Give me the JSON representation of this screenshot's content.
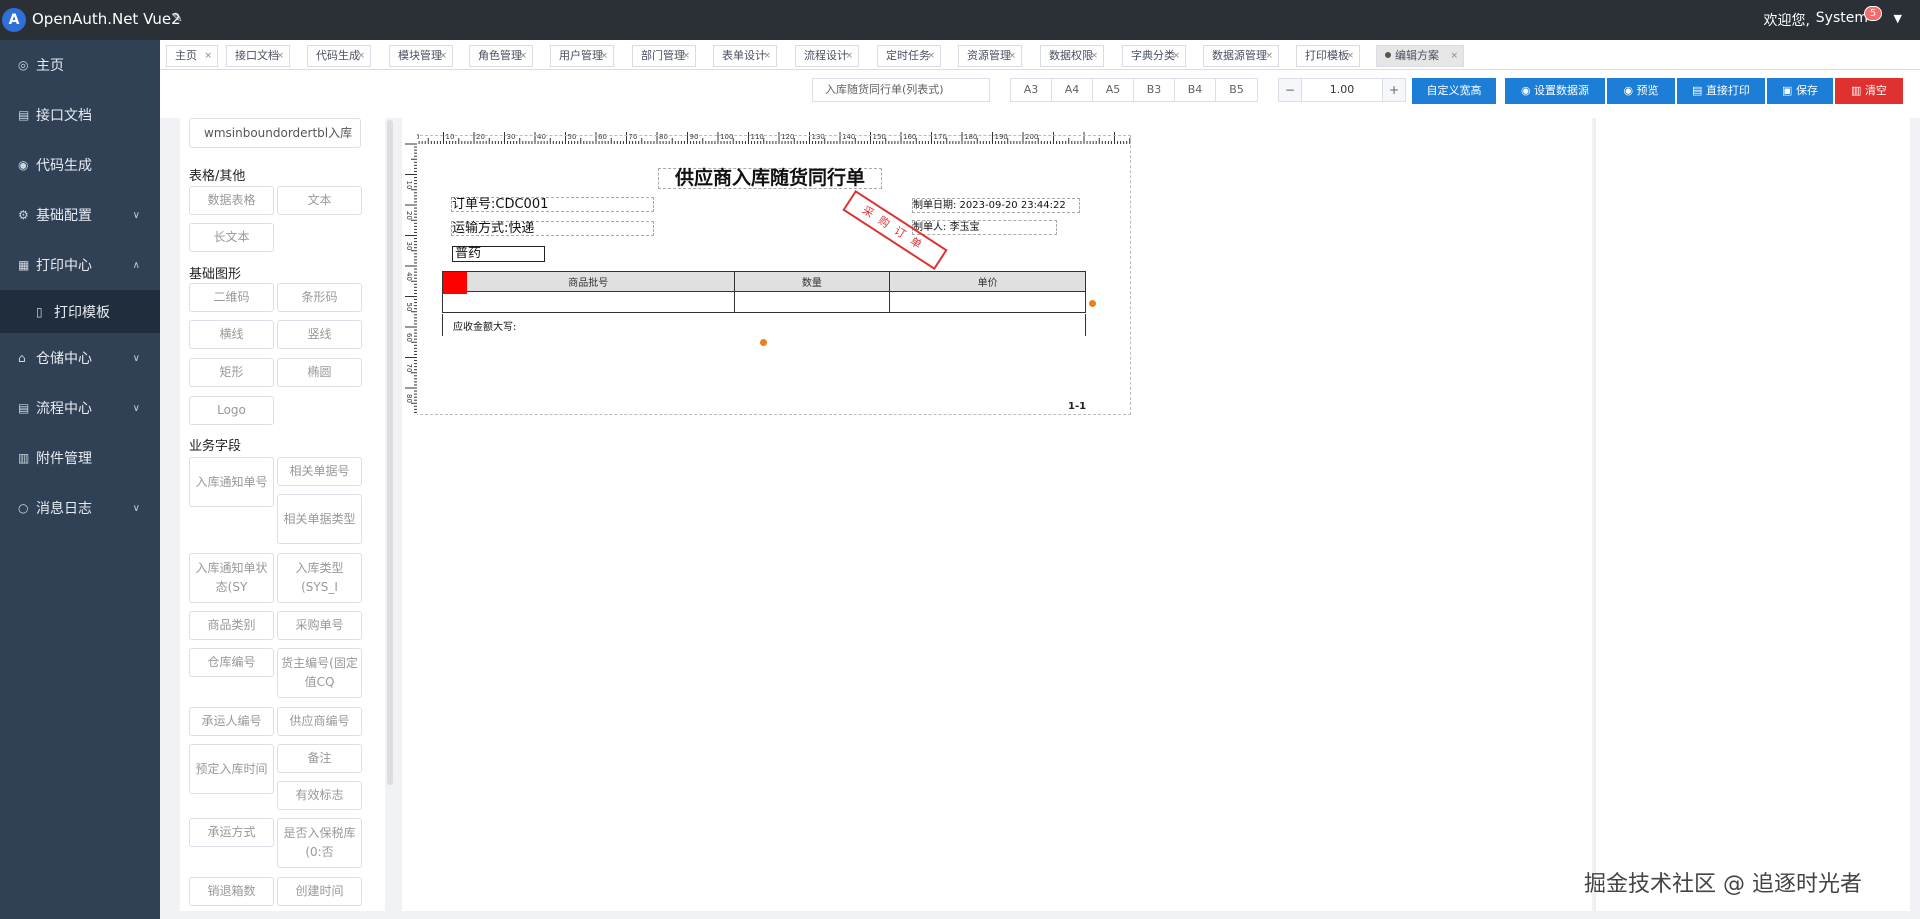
{
  "header": {
    "logo_letter": "A",
    "title": "OpenAuth.Net Vue2",
    "welcome": "欢迎您,",
    "user": "System",
    "badge": "5"
  },
  "sidebar": {
    "items": [
      {
        "label": "主页",
        "icon": "home-icon"
      },
      {
        "label": "接口文档",
        "icon": "doc-icon"
      },
      {
        "label": "代码生成",
        "icon": "check-circle-icon"
      },
      {
        "label": "基础配置",
        "icon": "gear-icon"
      },
      {
        "label": "打印中心",
        "icon": "printer-icon"
      },
      {
        "label": "打印模板",
        "icon": "file-icon"
      },
      {
        "label": "仓储中心",
        "icon": "warehouse-icon"
      },
      {
        "label": "流程中心",
        "icon": "flow-icon"
      },
      {
        "label": "附件管理",
        "icon": "attachment-icon"
      },
      {
        "label": "消息日志",
        "icon": "search-icon"
      }
    ]
  },
  "tabs": [
    "主页",
    "接口文档",
    "代码生成",
    "模块管理",
    "角色管理",
    "用户管理",
    "部门管理",
    "表单设计",
    "流程设计",
    "定时任务",
    "资源管理",
    "数据权限",
    "字典分类",
    "数据源管理",
    "打印模板",
    "编辑方案"
  ],
  "toolbar": {
    "template_name": "入库随货同行单(列表式)",
    "papers": [
      "A3",
      "A4",
      "A5",
      "B3",
      "B4",
      "B5"
    ],
    "zoom_minus": "−",
    "zoom": "1.00",
    "zoom_plus": "+",
    "custom_size": "自定义宽高",
    "set_datasource": "设置数据源",
    "preview": "预览",
    "print": "直接打印",
    "save": "保存",
    "clear": "清空"
  },
  "leftpanel": {
    "select_value": "wmsinboundordertbl入库",
    "group_table": "表格/其他",
    "table_items": [
      "数据表格",
      "文本",
      "长文本"
    ],
    "group_shapes": "基础图形",
    "shape_items": [
      "二维码",
      "条形码",
      "横线",
      "竖线",
      "矩形",
      "椭圆",
      "Logo"
    ],
    "group_fields": "业务字段",
    "field_items": [
      "入库通知单号",
      "相关单据号",
      "相关单据类型",
      "入库通知单状态(SY",
      "入库类型(SYS_I",
      "商品类别",
      "采购单号",
      "仓库编号",
      "货主编号(固定值CQ",
      "承运人编号",
      "供应商编号",
      "预定入库时间",
      "备注",
      "有效标志",
      "承运方式",
      "是否入保税库(0:否",
      "销退箱数",
      "创建时间"
    ]
  },
  "document": {
    "title": "供应商入库随货同行单",
    "order_no": "订单号:CDC001",
    "ship_method": "运输方式:快递",
    "date": "制单日期: 2023-09-20 23:44:22",
    "maker": "制单人: 李玉宝",
    "stamp": "采购订单",
    "category": "普药",
    "col_batch": "商品批号",
    "col_qty": "数量",
    "col_price": "单价",
    "amount_label": "应收金额大写:",
    "page": "1-1"
  },
  "ruler": {
    "h_ticks": [
      "0",
      "10",
      "20",
      "30",
      "40",
      "50",
      "60",
      "70",
      "80",
      "90",
      "100",
      "110",
      "120",
      "130",
      "140",
      "150",
      "160",
      "170",
      "180",
      "190",
      "200"
    ],
    "v_ticks": [
      "10",
      "20",
      "30",
      "40",
      "50",
      "60",
      "70",
      "80"
    ]
  },
  "watermark": "掘金技术社区 @ 追逐时光者"
}
